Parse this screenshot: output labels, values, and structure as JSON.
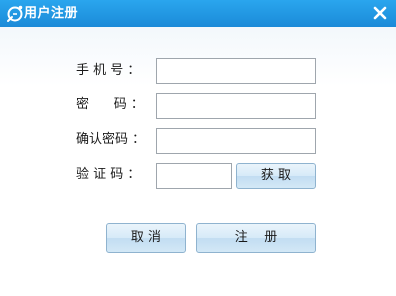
{
  "window": {
    "title": "用户注册",
    "title_bar_color": "#1b8ad8",
    "app_icon": "app-logo-icon",
    "close_icon": "close-icon"
  },
  "form": {
    "phone_label": "手 机 号 ：",
    "phone_value": "",
    "password_label": "密      码 ：",
    "password_value": "",
    "confirm_label": "确认密码 ：",
    "confirm_value": "",
    "code_label": "验 证 码 ：",
    "code_value": ""
  },
  "buttons": {
    "get_code": "获 取",
    "cancel": "取 消",
    "register": "注    册"
  }
}
